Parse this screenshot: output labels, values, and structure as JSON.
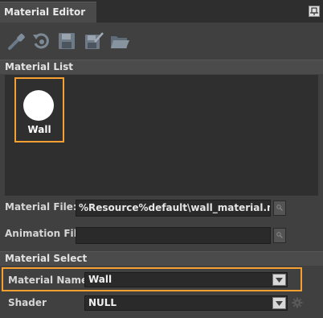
{
  "window": {
    "title": "Material Editor"
  },
  "toolbar": {
    "tools": [
      {
        "icon": "eyedropper-icon"
      },
      {
        "icon": "reset-icon"
      },
      {
        "icon": "save-icon"
      },
      {
        "icon": "save-as-icon"
      },
      {
        "icon": "open-folder-icon"
      }
    ]
  },
  "material_list": {
    "header": "Material List",
    "items": [
      {
        "label": "Wall",
        "selected": true
      }
    ]
  },
  "material_file": {
    "label": "Material File:",
    "value": "%Resource%default\\wall_material.mtl"
  },
  "animation_file": {
    "label": "Animation File:",
    "value": ""
  },
  "material_select": {
    "header": "Material Select",
    "material_name": {
      "label": "Material Name",
      "value": "Wall"
    },
    "shader": {
      "label": "Shader",
      "value": "NULL"
    }
  },
  "colors": {
    "highlight": "#f5a030",
    "panel": "#404040",
    "field": "#2a2a2a"
  }
}
